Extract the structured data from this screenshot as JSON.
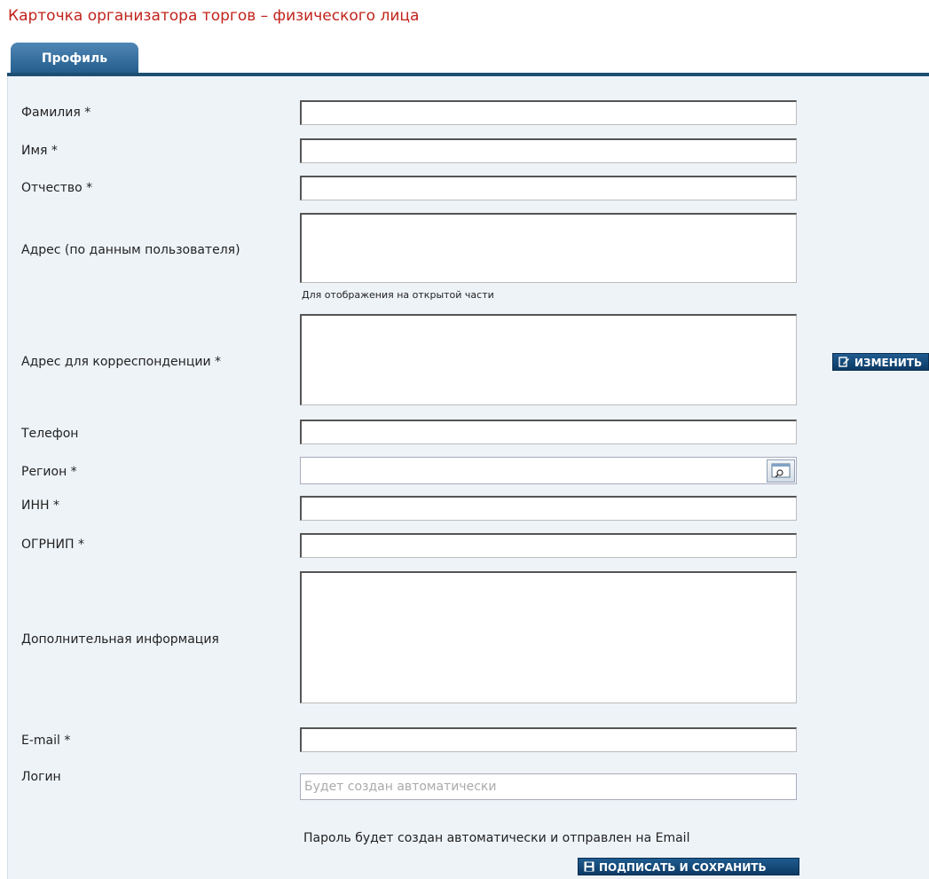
{
  "page": {
    "title": "Карточка организатора торгов – физического лица"
  },
  "tabs": [
    {
      "label": "Профиль"
    }
  ],
  "form": {
    "last_name_label": "Фамилия *",
    "first_name_label": "Имя *",
    "patronymic_label": "Отчество *",
    "address_label": "Адрес (по данным пользователя)",
    "address_hint": "Для отображения на открытой части",
    "corr_address_label": "Адрес для корреспонденции *",
    "change_button": "ИЗМЕНИТЬ",
    "phone_label": "Телефон",
    "region_label": "Регион *",
    "inn_label": "ИНН *",
    "ogrnip_label": "ОГРНИП *",
    "extra_info_label": "Дополнительная информация",
    "email_label": "E-mail *",
    "login_label": "Логин",
    "login_placeholder": "Будет создан автоматически",
    "password_note": "Пароль будет создан автоматически и отправлен на Email",
    "sign_save_button": "ПОДПИСАТЬ И СОХРАНИТЬ"
  },
  "icons": {
    "region_lookup": "lookup-window-icon",
    "change": "edit-icon",
    "save": "floppy-disk-icon"
  },
  "colors": {
    "title": "#c0241c",
    "tab": "#2a6496",
    "button": "#164a7a",
    "panel": "#eef3f8"
  }
}
